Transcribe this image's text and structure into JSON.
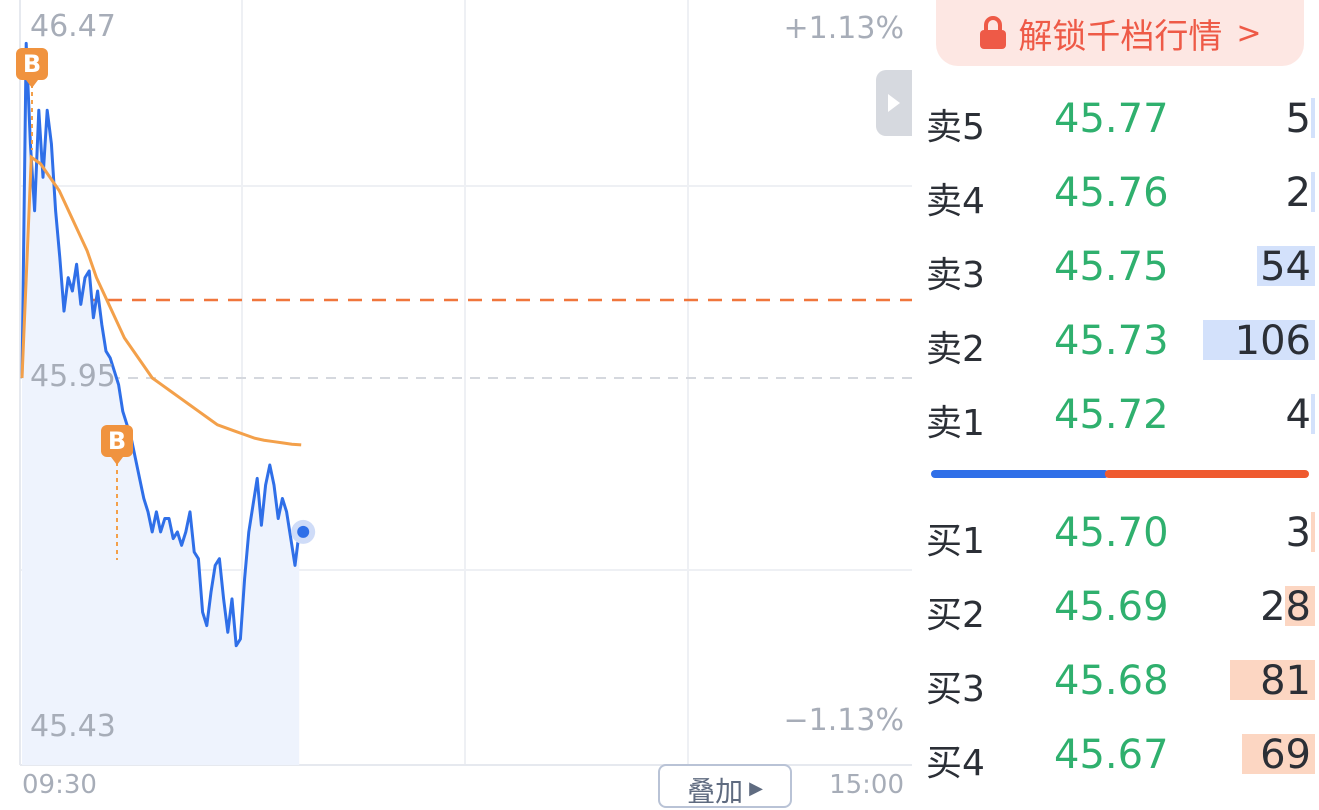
{
  "chart": {
    "price_high": "46.47",
    "price_mid": "45.95",
    "price_low": "45.43",
    "pct_high": "+1.13%",
    "pct_low": "−1.13%",
    "time_start": "09:30",
    "time_end": "15:00",
    "overlay_label": "叠加",
    "buy_marker_label": "B",
    "colors": {
      "price_line": "#2f6fe8",
      "avg_line": "#f3a04a",
      "ref_line": "#f0763c",
      "area_fill": "#eef3fd"
    }
  },
  "chart_data": {
    "type": "line",
    "ylim": [
      45.43,
      46.47
    ],
    "series": [
      {
        "values": [
          45.95,
          46.45,
          46.3,
          46.2,
          46.35,
          46.25,
          46.35,
          46.3,
          46.2,
          46.13,
          46.05,
          46.1,
          46.08,
          46.12,
          46.06,
          46.1,
          46.11,
          46.04,
          46.08,
          46.03,
          45.99,
          45.98,
          45.96,
          45.94,
          45.9,
          45.88,
          45.86,
          45.83,
          45.8,
          45.77,
          45.75,
          45.72,
          45.75,
          45.72,
          45.74,
          45.74,
          45.71,
          45.72,
          45.7,
          45.72,
          45.75,
          45.69,
          45.68,
          45.6,
          45.58,
          45.63,
          45.67,
          45.68,
          45.62,
          45.57,
          45.62,
          45.55,
          45.56,
          45.65,
          45.72,
          45.76,
          45.8,
          45.73,
          45.79,
          45.82,
          45.79,
          45.74,
          45.77,
          45.75,
          45.71,
          45.67,
          45.72
        ]
      },
      {
        "values": [
          45.95,
          46.28,
          46.27,
          46.25,
          46.23,
          46.2,
          46.17,
          46.14,
          46.1,
          46.07,
          46.04,
          46.01,
          45.99,
          45.97,
          45.95,
          45.94,
          45.93,
          45.92,
          45.91,
          45.9,
          45.89,
          45.88,
          45.875,
          45.87,
          45.865,
          45.86,
          45.857,
          45.855,
          45.853,
          45.851,
          45.85
        ]
      }
    ]
  },
  "order_book": {
    "unlock_label": "解锁千档行情",
    "unlock_chevron": ">",
    "asks": [
      {
        "level": "卖5",
        "price": "45.77",
        "volume": "5",
        "fill": 0.02
      },
      {
        "level": "卖4",
        "price": "45.76",
        "volume": "2",
        "fill": 0.02
      },
      {
        "level": "卖3",
        "price": "45.75",
        "volume": "54",
        "fill": 0.52
      },
      {
        "level": "卖2",
        "price": "45.73",
        "volume": "106",
        "fill": 1.0
      },
      {
        "level": "卖1",
        "price": "45.72",
        "volume": "4",
        "fill": 0.03
      }
    ],
    "bids": [
      {
        "level": "买1",
        "price": "45.70",
        "volume": "3",
        "fill": 0.03
      },
      {
        "level": "买2",
        "price": "45.69",
        "volume": "28",
        "fill": 0.27
      },
      {
        "level": "买3",
        "price": "45.68",
        "volume": "81",
        "fill": 0.76
      },
      {
        "level": "买4",
        "price": "45.67",
        "volume": "69",
        "fill": 0.65
      }
    ],
    "ratio": {
      "buy_fraction": 0.46,
      "buy_color": "#2f6fe8",
      "sell_color": "#ef5a2f"
    }
  }
}
